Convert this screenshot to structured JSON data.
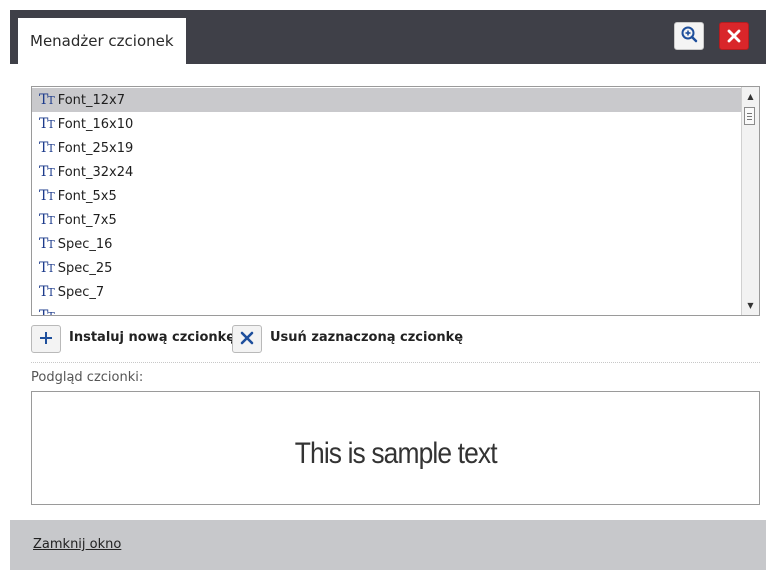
{
  "window": {
    "title": "Menadżer czcionek",
    "zoom_icon": "zoom-in-icon",
    "close_icon": "close-icon",
    "close_color": "#d9262a"
  },
  "font_list": {
    "items": [
      {
        "label": "Font_12x7",
        "selected": true
      },
      {
        "label": "Font_16x10",
        "selected": false
      },
      {
        "label": "Font_25x19",
        "selected": false
      },
      {
        "label": "Font_32x24",
        "selected": false
      },
      {
        "label": "Font_5x5",
        "selected": false
      },
      {
        "label": "Font_7x5",
        "selected": false
      },
      {
        "label": "Spec_16",
        "selected": false
      },
      {
        "label": "Spec_25",
        "selected": false
      },
      {
        "label": "Spec_7",
        "selected": false
      }
    ],
    "item_icon": "font-tt-icon",
    "icon_glyph_big": "T",
    "icon_glyph_small": "T"
  },
  "actions": {
    "install_label": "Instaluj nową czcionkę",
    "install_icon": "plus-icon",
    "remove_label": "Usuń zaznaczoną czcionkę",
    "remove_icon": "x-icon"
  },
  "preview": {
    "label": "Podgląd czcionki:",
    "sample_text": "This is sample text"
  },
  "footer": {
    "close_link": "Zamknij okno"
  }
}
